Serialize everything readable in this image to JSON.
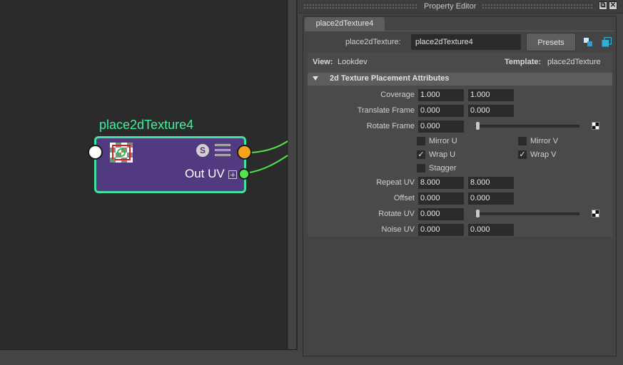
{
  "node_editor": {
    "node": {
      "title": "place2dTexture4",
      "output_label": "Out UV",
      "s_badge": "S",
      "icons": [
        "texture-placement-icon",
        "swatch-s-icon",
        "attribute-list-icon",
        "expand-plus-icon"
      ]
    },
    "colors": {
      "canvas_bg": "#2b2b2b",
      "node_body": "#523a80",
      "node_border": "#3fe29e",
      "node_title": "#3ef0a0",
      "port_output": "#f7a21b",
      "port_out_uv": "#52e24c",
      "connection": "#52e24c"
    }
  },
  "property_editor": {
    "window_title": "Property Editor",
    "window_buttons": {
      "restore": "⧉",
      "close": "✕"
    },
    "tabs": [
      {
        "label": "place2dTexture4",
        "active": true
      }
    ],
    "node_type_label": "place2dTexture:",
    "node_name_value": "place2dTexture4",
    "presets_label": "Presets",
    "view_label": "View:",
    "view_value": "Lookdev",
    "template_label": "Template:",
    "template_value": "place2dTexture",
    "section": {
      "title": "2d Texture Placement Attributes",
      "expanded": true,
      "rows": {
        "coverage": {
          "label": "Coverage",
          "v1": "1.000",
          "v2": "1.000"
        },
        "translate_frame": {
          "label": "Translate Frame",
          "v1": "0.000",
          "v2": "0.000"
        },
        "rotate_frame": {
          "label": "Rotate Frame",
          "v1": "0.000",
          "slider": 0.0
        },
        "mirror_u": {
          "label": "Mirror U",
          "checked": false
        },
        "mirror_v": {
          "label": "Mirror V",
          "checked": false
        },
        "wrap_u": {
          "label": "Wrap U",
          "checked": true
        },
        "wrap_v": {
          "label": "Wrap V",
          "checked": true
        },
        "stagger": {
          "label": "Stagger",
          "checked": false
        },
        "repeat_uv": {
          "label": "Repeat UV",
          "v1": "8.000",
          "v2": "8.000"
        },
        "offset": {
          "label": "Offset",
          "v1": "0.000",
          "v2": "0.000"
        },
        "rotate_uv": {
          "label": "Rotate UV",
          "v1": "0.000",
          "slider": 0.0
        },
        "noise_uv": {
          "label": "Noise UV",
          "v1": "0.000",
          "v2": "0.000"
        }
      }
    },
    "check_glyph": "✓"
  }
}
